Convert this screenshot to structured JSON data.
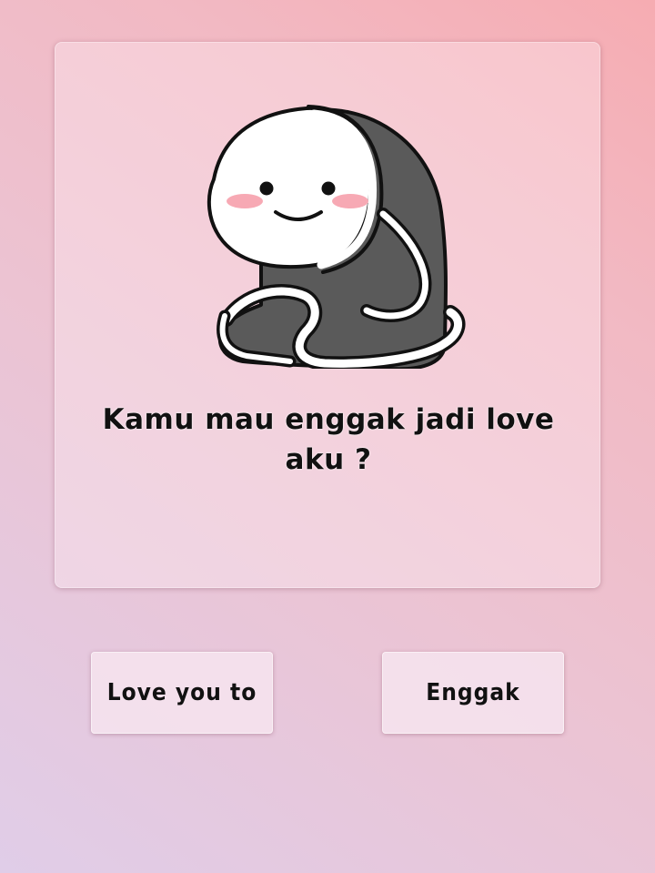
{
  "card": {
    "image": "cute-blanket-mascot",
    "question": "Kamu mau enggak jadi love aku ?"
  },
  "buttons": {
    "yes_label": "Love you to",
    "no_label": "Enggak"
  },
  "colors": {
    "background_start": "#e0cde8",
    "background_end": "#f6acb2",
    "blanket": "#5a5a5a",
    "blush": "#f7a9b4",
    "text": "#111111"
  }
}
